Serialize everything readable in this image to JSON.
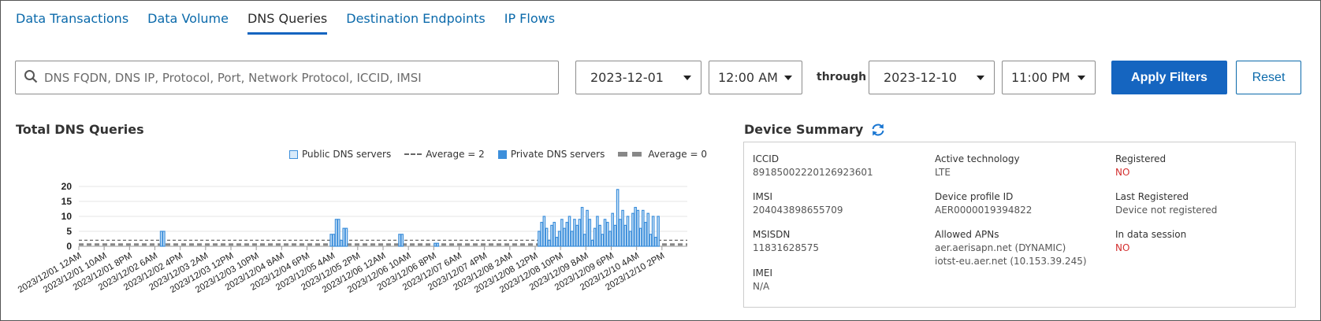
{
  "tabs": [
    {
      "label": "Data Transactions",
      "active": false
    },
    {
      "label": "Data Volume",
      "active": false
    },
    {
      "label": "DNS Queries",
      "active": true
    },
    {
      "label": "Destination Endpoints",
      "active": false
    },
    {
      "label": "IP Flows",
      "active": false
    }
  ],
  "filters": {
    "search_placeholder": "DNS FQDN, DNS IP, Protocol, Port, Network Protocol, ICCID, IMSI",
    "search_icon": "search-icon",
    "start_date": "2023-12-01",
    "start_time": "12:00 AM",
    "through_label": "through",
    "end_date": "2023-12-10",
    "end_time": "11:00 PM",
    "apply_label": "Apply Filters",
    "reset_label": "Reset"
  },
  "colors": {
    "accent": "#1565c0",
    "link": "#0b6aab",
    "bar_public": "#3d8fdb",
    "bar_public_fill": "#d8eafa",
    "negative": "#d32f2f"
  },
  "chart_data": {
    "type": "bar",
    "title": "Total DNS Queries",
    "legend": [
      "Public DNS servers",
      "Average = 2",
      "Private DNS servers",
      "Average = 0"
    ],
    "legend_position": "top-right",
    "ylim": [
      0,
      20
    ],
    "yticks": [
      0,
      5,
      10,
      15,
      20
    ],
    "grid": true,
    "xticks": [
      "2023/12/01 12AM",
      "2023/12/01 10AM",
      "2023/12/01 8PM",
      "2023/12/02 6AM",
      "2023/12/02 4PM",
      "2023/12/03 2AM",
      "2023/12/03 12PM",
      "2023/12/03 10PM",
      "2023/12/04 8AM",
      "2023/12/04 6PM",
      "2023/12/05 4AM",
      "2023/12/05 2PM",
      "2023/12/06 12AM",
      "2023/12/06 10AM",
      "2023/12/06 8PM",
      "2023/12/07 6AM",
      "2023/12/07 4PM",
      "2023/12/08 2AM",
      "2023/12/08 12PM",
      "2023/12/08 10PM",
      "2023/12/09 8AM",
      "2023/12/09 6PM",
      "2023/12/10 4AM",
      "2023/12/10 2PM"
    ],
    "hours": 240,
    "series": [
      {
        "name": "Public DNS servers",
        "points": [
          [
            32,
            5
          ],
          [
            33,
            5
          ],
          [
            99,
            4
          ],
          [
            100,
            4
          ],
          [
            101,
            9
          ],
          [
            102,
            9
          ],
          [
            103,
            2
          ],
          [
            104,
            6
          ],
          [
            105,
            6
          ],
          [
            126,
            4
          ],
          [
            127,
            4
          ],
          [
            140,
            1
          ],
          [
            141,
            1
          ],
          [
            181,
            5
          ],
          [
            182,
            8
          ],
          [
            183,
            10
          ],
          [
            184,
            6
          ],
          [
            185,
            2
          ],
          [
            186,
            7
          ],
          [
            187,
            8
          ],
          [
            188,
            3
          ],
          [
            189,
            5
          ],
          [
            190,
            9
          ],
          [
            191,
            6
          ],
          [
            192,
            8
          ],
          [
            193,
            10
          ],
          [
            194,
            5
          ],
          [
            195,
            9
          ],
          [
            196,
            7
          ],
          [
            197,
            9
          ],
          [
            198,
            13
          ],
          [
            199,
            4
          ],
          [
            200,
            12
          ],
          [
            201,
            9
          ],
          [
            202,
            2
          ],
          [
            203,
            6
          ],
          [
            204,
            10
          ],
          [
            205,
            7
          ],
          [
            206,
            4
          ],
          [
            207,
            9
          ],
          [
            208,
            8
          ],
          [
            209,
            5
          ],
          [
            210,
            11
          ],
          [
            211,
            7
          ],
          [
            212,
            19
          ],
          [
            213,
            9
          ],
          [
            214,
            12
          ],
          [
            215,
            7
          ],
          [
            216,
            10
          ],
          [
            217,
            5
          ],
          [
            218,
            11
          ],
          [
            219,
            13
          ],
          [
            220,
            12
          ],
          [
            221,
            6
          ],
          [
            222,
            12
          ],
          [
            223,
            8
          ],
          [
            224,
            11
          ],
          [
            225,
            4
          ],
          [
            226,
            10
          ],
          [
            227,
            3
          ],
          [
            228,
            10
          ]
        ]
      },
      {
        "name": "Private DNS servers",
        "points": []
      }
    ],
    "averages": [
      {
        "name": "Average = 2",
        "value": 2
      },
      {
        "name": "Average = 0",
        "value": 0.6
      }
    ]
  },
  "device_summary": {
    "title": "Device Summary",
    "refresh_icon": "refresh-icon",
    "fields": {
      "iccid": {
        "label": "ICCID",
        "value": "89185002220126923601"
      },
      "imsi": {
        "label": "IMSI",
        "value": "204043898655709"
      },
      "msisdn": {
        "label": "MSISDN",
        "value": "11831628575"
      },
      "imei": {
        "label": "IMEI",
        "value": "N/A"
      },
      "active_technology": {
        "label": "Active technology",
        "value": "LTE"
      },
      "device_profile_id": {
        "label": "Device profile ID",
        "value": "AER0000019394822"
      },
      "allowed_apns": {
        "label": "Allowed APNs",
        "values": [
          "aer.aerisapn.net (DYNAMIC)",
          "iotst-eu.aer.net (10.153.39.245)"
        ]
      },
      "registered": {
        "label": "Registered",
        "value": "NO"
      },
      "last_registered": {
        "label": "Last Registered",
        "value": "Device not registered"
      },
      "in_data_session": {
        "label": "In data session",
        "value": "NO"
      }
    }
  }
}
